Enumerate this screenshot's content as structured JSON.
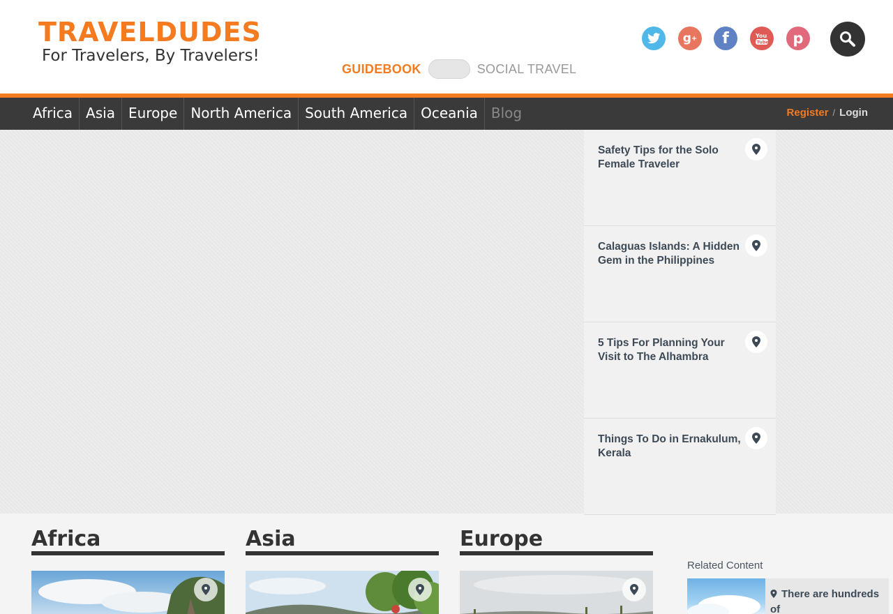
{
  "header": {
    "logo_main": "TRAVELDUDES",
    "logo_tagline": "For Travelers, By Travelers!",
    "mode_active": "GUIDEBOOK",
    "mode_inactive": "SOCIAL TRAVEL",
    "social_icons": [
      "twitter-icon",
      "google-plus-icon",
      "facebook-icon",
      "youtube-icon",
      "pinterest-icon"
    ],
    "search_icon": "search-icon"
  },
  "nav": {
    "items": [
      "Africa",
      "Asia",
      "Europe",
      "North America",
      "South America",
      "Oceania",
      "Blog"
    ],
    "register": "Register",
    "separator": "/",
    "login": "Login"
  },
  "featured": {
    "items": [
      {
        "title": "Safety Tips for the Solo Female Traveler",
        "icon": "location-pin-icon"
      },
      {
        "title": "Calaguas Islands: A Hidden Gem in the Philippines",
        "icon": "location-pin-icon"
      },
      {
        "title": "5 Tips For Planning Your Visit to The Alhambra",
        "icon": "location-pin-icon"
      },
      {
        "title": "Things To Do in Ernakulum, Kerala",
        "icon": "location-pin-icon"
      }
    ]
  },
  "regions": [
    {
      "title": "Africa",
      "icon": "location-pin-icon"
    },
    {
      "title": "Asia",
      "icon": "location-pin-icon"
    },
    {
      "title": "Europe",
      "icon": "location-pin-icon"
    }
  ],
  "related": {
    "label": "Related Content",
    "card_text": "There are hundreds of",
    "icon": "location-pin-icon"
  },
  "colors": {
    "brand_orange": "#f47b20",
    "nav_bg": "#3a3a3a",
    "twitter": "#4fb8e8",
    "google_plus": "#e8765f",
    "facebook": "#5f82c4",
    "youtube": "#e05a55",
    "pinterest": "#e06a7c"
  }
}
